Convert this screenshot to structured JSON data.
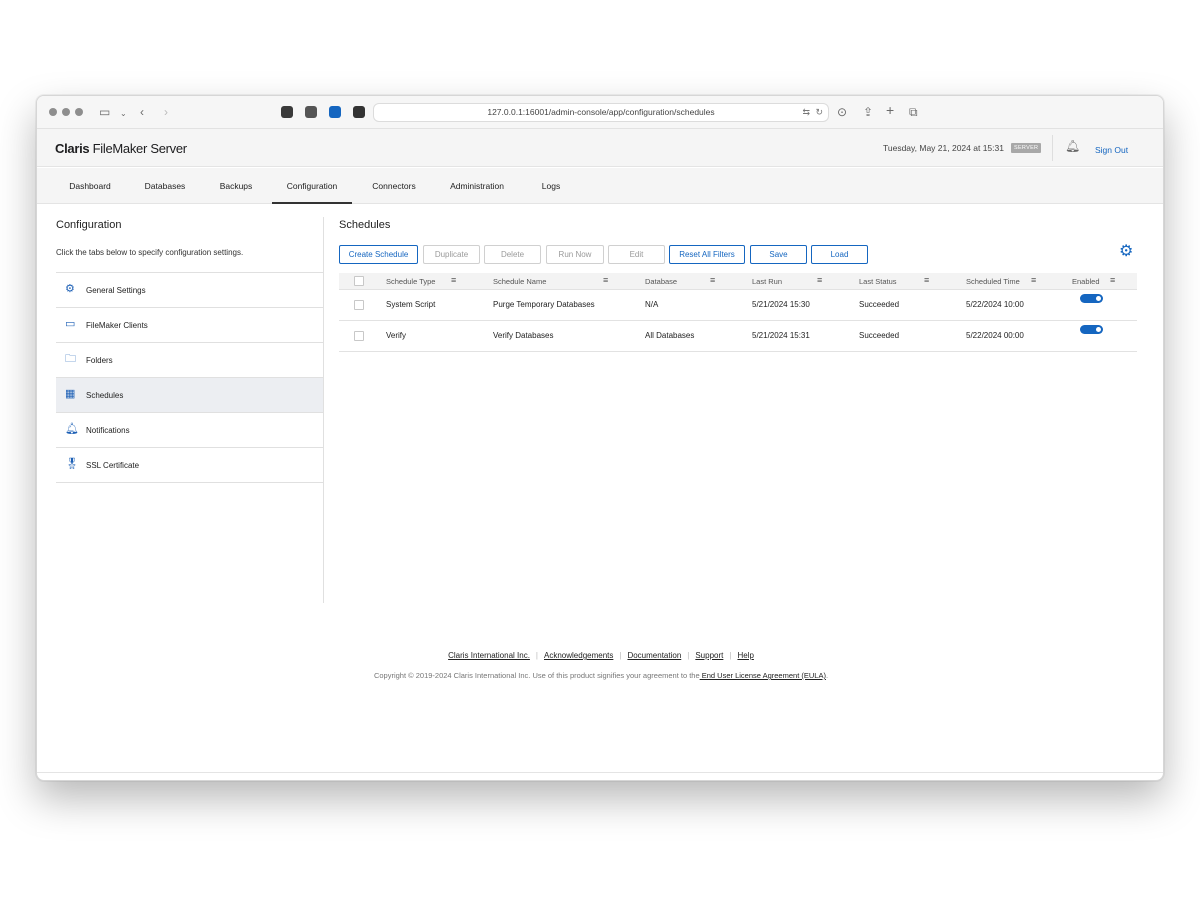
{
  "browser": {
    "url": "127.0.0.1:16001/admin-console/app/configuration/schedules"
  },
  "app": {
    "brand_bold": "Claris",
    "brand_rest": " FileMaker Server",
    "datetime": "Tuesday, May 21, 2024 at 15:31",
    "server_badge": "SERVER",
    "sign_out": "Sign Out"
  },
  "nav": {
    "tabs": [
      {
        "label": "Dashboard"
      },
      {
        "label": "Databases"
      },
      {
        "label": "Backups"
      },
      {
        "label": "Configuration",
        "active": true
      },
      {
        "label": "Connectors"
      },
      {
        "label": "Administration"
      },
      {
        "label": "Logs"
      }
    ]
  },
  "sidebar": {
    "title": "Configuration",
    "description": "Click the tabs below to specify configuration settings.",
    "items": [
      {
        "label": "General Settings",
        "icon": "gear-icon"
      },
      {
        "label": "FileMaker Clients",
        "icon": "clients-icon"
      },
      {
        "label": "Folders",
        "icon": "folder-icon"
      },
      {
        "label": "Schedules",
        "icon": "calendar-icon",
        "active": true
      },
      {
        "label": "Notifications",
        "icon": "bell-icon"
      },
      {
        "label": "SSL Certificate",
        "icon": "certificate-icon"
      }
    ]
  },
  "schedules": {
    "title": "Schedules",
    "buttons": [
      {
        "label": "Create Schedule",
        "enabled": true
      },
      {
        "label": "Duplicate",
        "enabled": false
      },
      {
        "label": "Delete",
        "enabled": false
      },
      {
        "label": "Run Now",
        "enabled": false
      },
      {
        "label": "Edit",
        "enabled": false
      },
      {
        "label": "Reset All Filters",
        "enabled": true
      },
      {
        "label": "Save",
        "enabled": true
      },
      {
        "label": "Load",
        "enabled": true
      }
    ],
    "columns": [
      "Schedule Type",
      "Schedule Name",
      "Database",
      "Last Run",
      "Last Status",
      "Scheduled Time",
      "Enabled"
    ],
    "rows": [
      {
        "type": "System Script",
        "name": "Purge Temporary Databases",
        "database": "N/A",
        "last_run": "5/21/2024 15:30",
        "status": "Succeeded",
        "scheduled": "5/22/2024 10:00",
        "enabled": true
      },
      {
        "type": "Verify",
        "name": "Verify Databases",
        "database": "All Databases",
        "last_run": "5/21/2024 15:31",
        "status": "Succeeded",
        "scheduled": "5/22/2024 00:00",
        "enabled": true
      }
    ]
  },
  "footer": {
    "links": [
      "Claris International Inc.",
      "Acknowledgements",
      "Documentation",
      "Support",
      "Help"
    ],
    "copyright": "Copyright © 2019-2024 Claris International Inc. Use of this product signifies your agreement to the",
    "eula": " End User License Agreement (EULA)",
    "period": "."
  },
  "colors": {
    "accent": "#1566c0",
    "active_sidebar_bg": "#eceef2"
  }
}
